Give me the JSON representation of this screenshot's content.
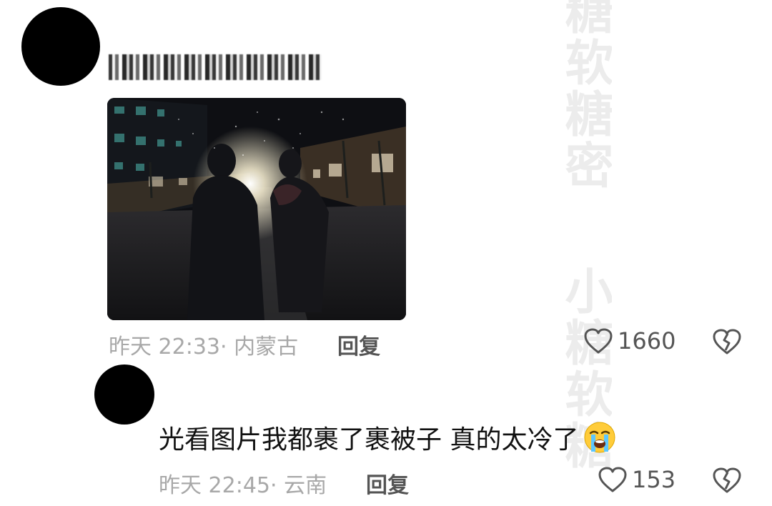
{
  "watermark": {
    "text_top": "糖软糖密",
    "text_bottom": "小糖软糖"
  },
  "comment1": {
    "meta": "昨天 22:33· 内蒙古",
    "reply_label": "回复",
    "like_count": "1660"
  },
  "comment2": {
    "text": "光看图片我都裹了裹被子 真的太冷了",
    "emoji": "loudly-crying-face",
    "meta": "昨天 22:45· 云南",
    "reply_label": "回复",
    "like_count": "153"
  },
  "icons": {
    "like": "heart-outline-icon",
    "dislike": "broken-heart-icon"
  }
}
